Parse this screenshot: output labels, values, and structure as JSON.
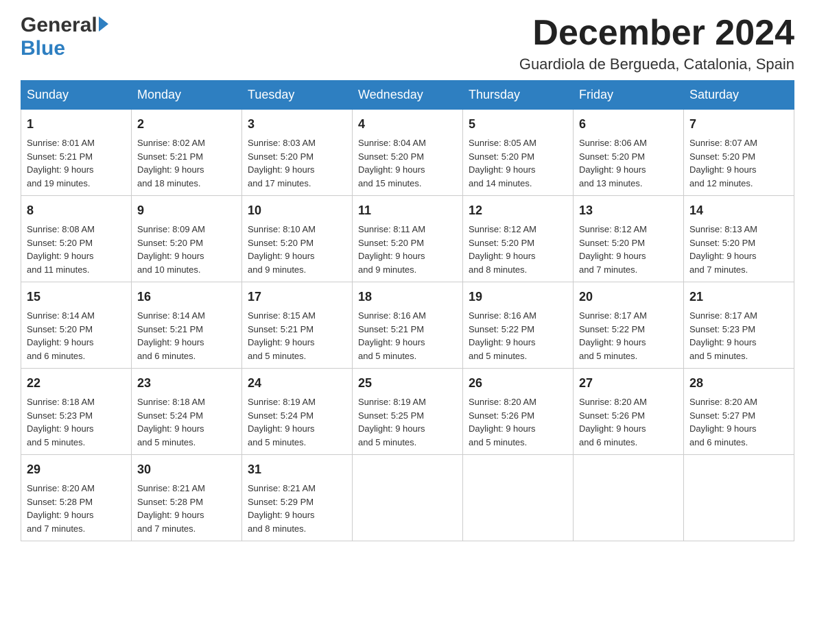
{
  "header": {
    "logo_general": "General",
    "logo_blue": "Blue",
    "month_title": "December 2024",
    "location": "Guardiola de Bergueda, Catalonia, Spain"
  },
  "days_of_week": [
    "Sunday",
    "Monday",
    "Tuesday",
    "Wednesday",
    "Thursday",
    "Friday",
    "Saturday"
  ],
  "weeks": [
    [
      {
        "day": "1",
        "sunrise": "8:01 AM",
        "sunset": "5:21 PM",
        "daylight": "9 hours and 19 minutes."
      },
      {
        "day": "2",
        "sunrise": "8:02 AM",
        "sunset": "5:21 PM",
        "daylight": "9 hours and 18 minutes."
      },
      {
        "day": "3",
        "sunrise": "8:03 AM",
        "sunset": "5:20 PM",
        "daylight": "9 hours and 17 minutes."
      },
      {
        "day": "4",
        "sunrise": "8:04 AM",
        "sunset": "5:20 PM",
        "daylight": "9 hours and 15 minutes."
      },
      {
        "day": "5",
        "sunrise": "8:05 AM",
        "sunset": "5:20 PM",
        "daylight": "9 hours and 14 minutes."
      },
      {
        "day": "6",
        "sunrise": "8:06 AM",
        "sunset": "5:20 PM",
        "daylight": "9 hours and 13 minutes."
      },
      {
        "day": "7",
        "sunrise": "8:07 AM",
        "sunset": "5:20 PM",
        "daylight": "9 hours and 12 minutes."
      }
    ],
    [
      {
        "day": "8",
        "sunrise": "8:08 AM",
        "sunset": "5:20 PM",
        "daylight": "9 hours and 11 minutes."
      },
      {
        "day": "9",
        "sunrise": "8:09 AM",
        "sunset": "5:20 PM",
        "daylight": "9 hours and 10 minutes."
      },
      {
        "day": "10",
        "sunrise": "8:10 AM",
        "sunset": "5:20 PM",
        "daylight": "9 hours and 9 minutes."
      },
      {
        "day": "11",
        "sunrise": "8:11 AM",
        "sunset": "5:20 PM",
        "daylight": "9 hours and 9 minutes."
      },
      {
        "day": "12",
        "sunrise": "8:12 AM",
        "sunset": "5:20 PM",
        "daylight": "9 hours and 8 minutes."
      },
      {
        "day": "13",
        "sunrise": "8:12 AM",
        "sunset": "5:20 PM",
        "daylight": "9 hours and 7 minutes."
      },
      {
        "day": "14",
        "sunrise": "8:13 AM",
        "sunset": "5:20 PM",
        "daylight": "9 hours and 7 minutes."
      }
    ],
    [
      {
        "day": "15",
        "sunrise": "8:14 AM",
        "sunset": "5:20 PM",
        "daylight": "9 hours and 6 minutes."
      },
      {
        "day": "16",
        "sunrise": "8:14 AM",
        "sunset": "5:21 PM",
        "daylight": "9 hours and 6 minutes."
      },
      {
        "day": "17",
        "sunrise": "8:15 AM",
        "sunset": "5:21 PM",
        "daylight": "9 hours and 5 minutes."
      },
      {
        "day": "18",
        "sunrise": "8:16 AM",
        "sunset": "5:21 PM",
        "daylight": "9 hours and 5 minutes."
      },
      {
        "day": "19",
        "sunrise": "8:16 AM",
        "sunset": "5:22 PM",
        "daylight": "9 hours and 5 minutes."
      },
      {
        "day": "20",
        "sunrise": "8:17 AM",
        "sunset": "5:22 PM",
        "daylight": "9 hours and 5 minutes."
      },
      {
        "day": "21",
        "sunrise": "8:17 AM",
        "sunset": "5:23 PM",
        "daylight": "9 hours and 5 minutes."
      }
    ],
    [
      {
        "day": "22",
        "sunrise": "8:18 AM",
        "sunset": "5:23 PM",
        "daylight": "9 hours and 5 minutes."
      },
      {
        "day": "23",
        "sunrise": "8:18 AM",
        "sunset": "5:24 PM",
        "daylight": "9 hours and 5 minutes."
      },
      {
        "day": "24",
        "sunrise": "8:19 AM",
        "sunset": "5:24 PM",
        "daylight": "9 hours and 5 minutes."
      },
      {
        "day": "25",
        "sunrise": "8:19 AM",
        "sunset": "5:25 PM",
        "daylight": "9 hours and 5 minutes."
      },
      {
        "day": "26",
        "sunrise": "8:20 AM",
        "sunset": "5:26 PM",
        "daylight": "9 hours and 5 minutes."
      },
      {
        "day": "27",
        "sunrise": "8:20 AM",
        "sunset": "5:26 PM",
        "daylight": "9 hours and 6 minutes."
      },
      {
        "day": "28",
        "sunrise": "8:20 AM",
        "sunset": "5:27 PM",
        "daylight": "9 hours and 6 minutes."
      }
    ],
    [
      {
        "day": "29",
        "sunrise": "8:20 AM",
        "sunset": "5:28 PM",
        "daylight": "9 hours and 7 minutes."
      },
      {
        "day": "30",
        "sunrise": "8:21 AM",
        "sunset": "5:28 PM",
        "daylight": "9 hours and 7 minutes."
      },
      {
        "day": "31",
        "sunrise": "8:21 AM",
        "sunset": "5:29 PM",
        "daylight": "9 hours and 8 minutes."
      },
      null,
      null,
      null,
      null
    ]
  ],
  "labels": {
    "sunrise": "Sunrise:",
    "sunset": "Sunset:",
    "daylight": "Daylight:"
  }
}
